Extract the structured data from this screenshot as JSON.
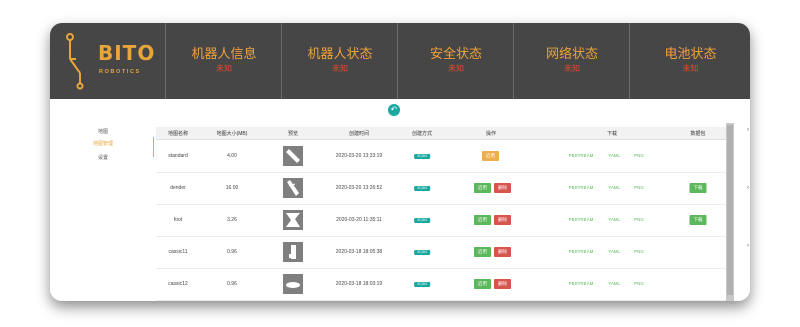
{
  "brand": {
    "name": "BITO",
    "sub": "ROBOTICS",
    "color": "#e8a53a"
  },
  "header": {
    "panels": [
      {
        "title": "机器人信息",
        "value": "未知"
      },
      {
        "title": "机器人状态",
        "value": "未知"
      },
      {
        "title": "安全状态",
        "value": "未知"
      },
      {
        "title": "网络状态",
        "value": "未知"
      },
      {
        "title": "电池状态",
        "value": "未知"
      }
    ]
  },
  "back_icon": "↶",
  "sidebar": {
    "items": [
      {
        "label": "地图"
      },
      {
        "label": "地图管理"
      },
      {
        "label": "设置"
      }
    ]
  },
  "table": {
    "headers": [
      "地图名称",
      "地图大小(MB)",
      "预览",
      "创建时间",
      "创建方式",
      "操作",
      "下载",
      "数据包"
    ],
    "rows": [
      {
        "name": "standard",
        "size": "4.00",
        "time": "2020-03-20 13:33:19",
        "method": "SCAN",
        "action1": "启用",
        "action2": "",
        "download": [
          "PBSTREAM",
          "YAML",
          "PNG"
        ],
        "pkg": ""
      },
      {
        "name": "dender",
        "size": "16.00",
        "time": "2020-03-20 13:26:52",
        "method": "SCAN",
        "action1": "启用",
        "action2": "删除",
        "download": [
          "PBSTREAM",
          "YAML",
          "PNG"
        ],
        "pkg": "下载"
      },
      {
        "name": "foot",
        "size": "3.26",
        "time": "2020-03-20 11:35:11",
        "method": "SCAN",
        "action1": "启用",
        "action2": "删除",
        "download": [
          "PBSTREAM",
          "YAML",
          "PNG"
        ],
        "pkg": "下载"
      },
      {
        "name": "cassic11",
        "size": "0.96",
        "time": "2020-03-18 18:05:38",
        "method": "SCAN",
        "action1": "启用",
        "action2": "删除",
        "download": [
          "PBSTREAM",
          "YAML",
          "PNG"
        ],
        "pkg": ""
      },
      {
        "name": "cassic12",
        "size": "0.96",
        "time": "2020-03-18 18:03:19",
        "method": "SCAN",
        "action1": "启用",
        "action2": "删除",
        "download": [
          "PBSTREAM",
          "YAML",
          "PNG"
        ],
        "pkg": ""
      }
    ]
  },
  "colors": {
    "accent": "#e8a53a",
    "teal": "#1aa9a1",
    "green": "#5cb85c",
    "red": "#d9534f",
    "header_bg": "#464646"
  }
}
